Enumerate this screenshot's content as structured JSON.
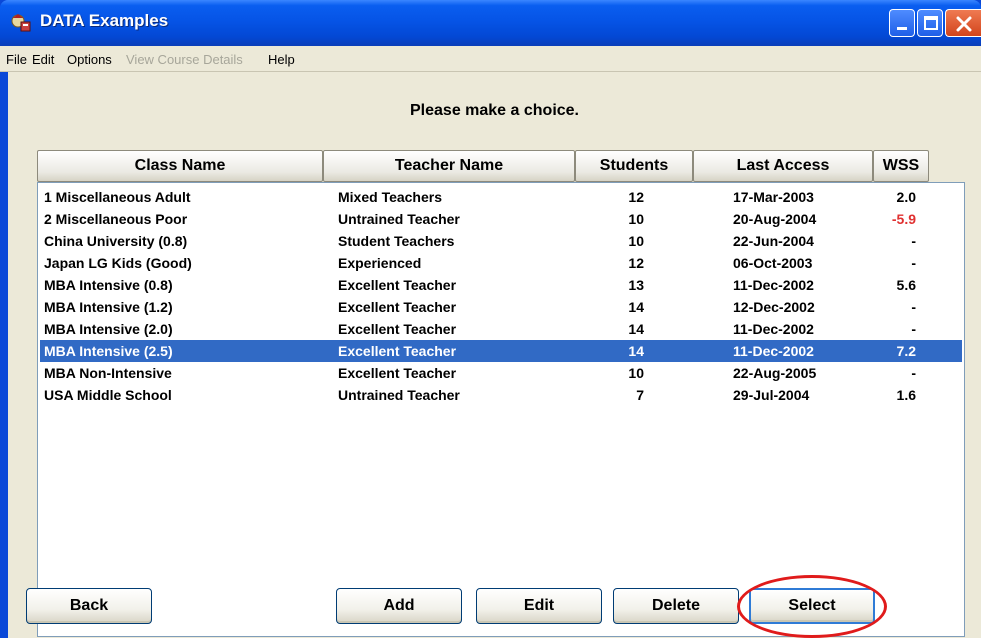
{
  "window": {
    "title": "DATA Examples"
  },
  "menu": [
    {
      "label": "File",
      "enabled": true
    },
    {
      "label": "Edit",
      "enabled": true
    },
    {
      "label": "Options",
      "enabled": true
    },
    {
      "label": "View Course Details",
      "enabled": false
    },
    {
      "label": "Help",
      "enabled": true
    }
  ],
  "prompt": "Please make a choice.",
  "columns": [
    "Class Name",
    "Teacher Name",
    "Students",
    "Last Access",
    "WSS"
  ],
  "rows": [
    {
      "class_name": "1 Miscellaneous Adult",
      "teacher": "Mixed Teachers",
      "students": "12",
      "last_access": "17-Mar-2003",
      "wss": "2.0"
    },
    {
      "class_name": "2 Miscellaneous Poor",
      "teacher": "Untrained Teacher",
      "students": "10",
      "last_access": "20-Aug-2004",
      "wss": "-5.9"
    },
    {
      "class_name": "China University (0.8)",
      "teacher": "Student Teachers",
      "students": "10",
      "last_access": "22-Jun-2004",
      "wss": "-"
    },
    {
      "class_name": "Japan LG Kids (Good)",
      "teacher": "Experienced",
      "students": "12",
      "last_access": "06-Oct-2003",
      "wss": "-"
    },
    {
      "class_name": "MBA Intensive (0.8)",
      "teacher": "Excellent Teacher",
      "students": "13",
      "last_access": "11-Dec-2002",
      "wss": "5.6"
    },
    {
      "class_name": "MBA Intensive (1.2)",
      "teacher": "Excellent Teacher",
      "students": "14",
      "last_access": "12-Dec-2002",
      "wss": "-"
    },
    {
      "class_name": "MBA Intensive (2.0)",
      "teacher": "Excellent Teacher",
      "students": "14",
      "last_access": "11-Dec-2002",
      "wss": "-"
    },
    {
      "class_name": "MBA Intensive (2.5)",
      "teacher": "Excellent Teacher",
      "students": "14",
      "last_access": "11-Dec-2002",
      "wss": "7.2",
      "selected": true
    },
    {
      "class_name": "MBA Non-Intensive",
      "teacher": "Excellent Teacher",
      "students": "10",
      "last_access": "22-Aug-2005",
      "wss": "-"
    },
    {
      "class_name": "USA Middle School",
      "teacher": "Untrained Teacher",
      "students": "7",
      "last_access": "29-Jul-2004",
      "wss": "1.6"
    }
  ],
  "buttons": {
    "back": "Back",
    "add": "Add",
    "edit": "Edit",
    "delete": "Delete",
    "select": "Select"
  },
  "colors": {
    "selection": "#316ac5",
    "negative": "#e03030",
    "highlight_circle": "#e01b1b",
    "titlebar": "#0654e6"
  }
}
